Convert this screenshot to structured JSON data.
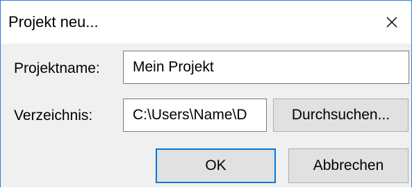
{
  "window": {
    "title": "Projekt neu...",
    "close_icon": "close-icon",
    "accent_color": "#0078d7"
  },
  "form": {
    "project_name_label": "Projektname:",
    "project_name_value": "Mein Projekt",
    "directory_label": "Verzeichnis:",
    "directory_value": "C:\\Users\\Name\\D"
  },
  "buttons": {
    "browse_label": "Durchsuchen...",
    "ok_label": "OK",
    "cancel_label": "Abbrechen"
  }
}
